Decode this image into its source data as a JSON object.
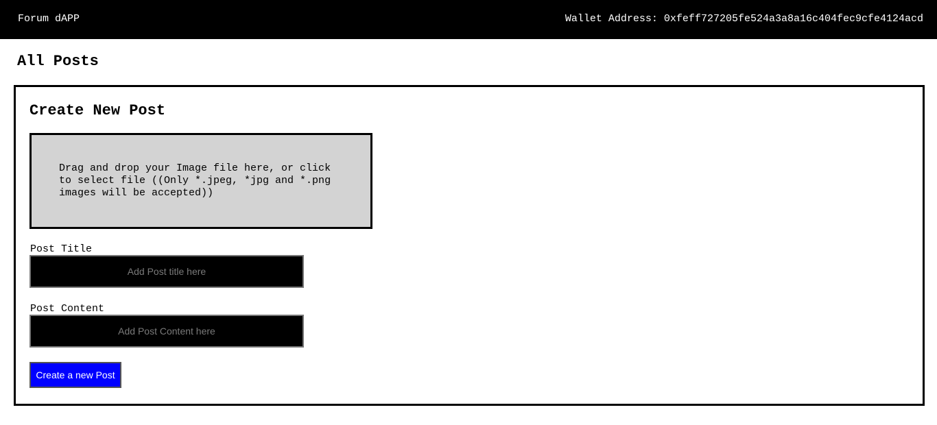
{
  "header": {
    "brand": "Forum dAPP",
    "wallet": "Wallet Address: 0xfeff727205fe524a3a8a16c404fec9cfe4124acd"
  },
  "page": {
    "title": "All Posts"
  },
  "create_post": {
    "title": "Create New Post",
    "dropzone_text": "Drag and drop your Image file here, or click to select file ((Only *.jpeg, *jpg and *.png images will be accepted))",
    "post_title_label": "Post Title",
    "post_title_placeholder": "Add Post title here",
    "post_title_value": "",
    "post_content_label": "Post Content",
    "post_content_placeholder": "Add Post Content here",
    "post_content_value": "",
    "submit_label": "Create a new Post"
  },
  "colors": {
    "header_bg": "#000000",
    "dropzone_bg": "#d3d3d3",
    "input_bg": "#000000",
    "button_bg": "#0000ff"
  }
}
